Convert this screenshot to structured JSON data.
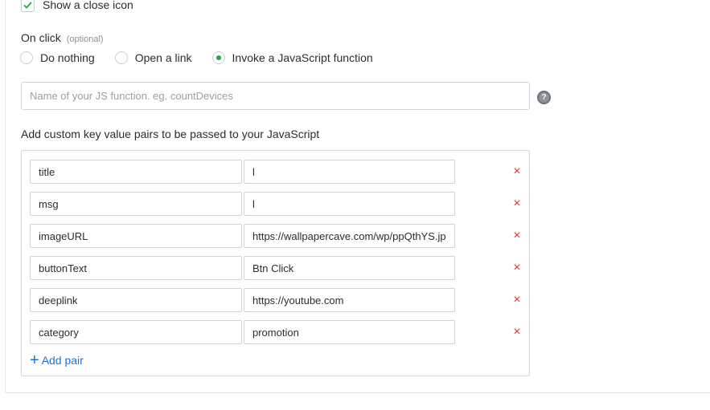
{
  "close_icon": {
    "label": "Show a close icon",
    "checked": true
  },
  "on_click": {
    "label": "On click",
    "optional_label": "(optional)",
    "options": [
      {
        "label": "Do nothing",
        "selected": false
      },
      {
        "label": "Open a link",
        "selected": false
      },
      {
        "label": "Invoke a JavaScript function",
        "selected": true
      }
    ]
  },
  "js_function": {
    "placeholder": "Name of your JS function. eg. countDevices",
    "value": "",
    "help_icon": "question-icon"
  },
  "custom_pairs": {
    "label": "Add custom key value pairs to be passed to your JavaScript",
    "pairs": [
      {
        "key": "title",
        "value": "l"
      },
      {
        "key": "msg",
        "value": "l"
      },
      {
        "key": "imageURL",
        "value": "https://wallpapercave.com/wp/ppQthYS.jpg"
      },
      {
        "key": "buttonText",
        "value": "Btn Click"
      },
      {
        "key": "deeplink",
        "value": "https://youtube.com"
      },
      {
        "key": "category",
        "value": "promotion"
      }
    ],
    "remove_icon": "×",
    "add_label": "Add pair"
  },
  "colors": {
    "accent_green": "#22a34a",
    "link_blue": "#1e6fd9",
    "remove_red": "#e0353b"
  }
}
